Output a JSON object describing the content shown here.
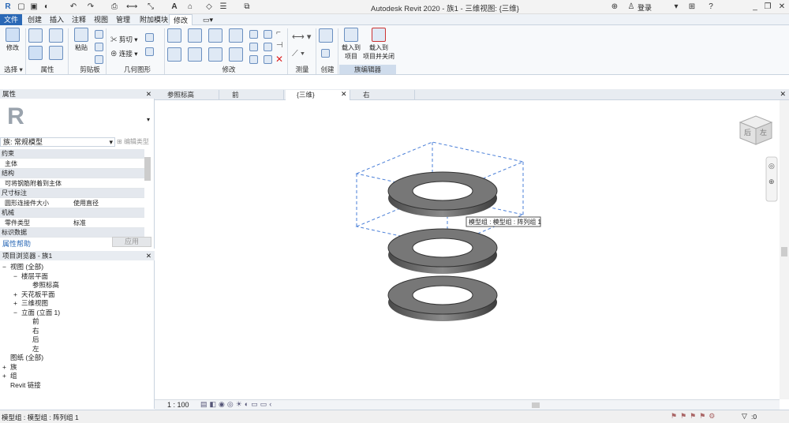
{
  "app_title": "Autodesk Revit 2020 - 族1 - 三维视图: {三维}",
  "signin": "登录",
  "ribbon_tabs": [
    "文件",
    "创建",
    "插入",
    "注释",
    "视图",
    "管理",
    "附加模块",
    "修改"
  ],
  "ribbon": {
    "modify_label": "修改",
    "select_label": "选择 ▾",
    "paste_label": "粘贴",
    "cut_label": "剪切",
    "join_label": "连接",
    "load_into_project": "载入到\n项目",
    "load_into_project_close": "载入到\n项目并关闭",
    "groups": [
      "选择",
      "属性",
      "剪贴板",
      "几何图形",
      "修改",
      "测量",
      "创建",
      "族编辑器"
    ]
  },
  "properties": {
    "title": "属性",
    "family_selector": "族: 常规模型",
    "edit_type": "编辑类型",
    "rows": [
      {
        "type": "section",
        "label": "约束"
      },
      {
        "type": "row",
        "key": "主体",
        "value": ""
      },
      {
        "type": "section",
        "label": "结构"
      },
      {
        "type": "row",
        "key": "可将钢筋附着到主体",
        "value": ""
      },
      {
        "type": "section",
        "label": "尺寸标注"
      },
      {
        "type": "row",
        "key": "圆形连接件大小",
        "value": "使用直径"
      },
      {
        "type": "section",
        "label": "机械"
      },
      {
        "type": "row",
        "key": "零件类型",
        "value": "标准"
      },
      {
        "type": "section",
        "label": "标识数据"
      }
    ],
    "help_link": "属性帮助",
    "apply_button": "应用"
  },
  "browser": {
    "title": "项目浏览器 - 族1",
    "items": [
      {
        "label": "视图 (全部)",
        "level": 0,
        "toggle": "−"
      },
      {
        "label": "楼层平面",
        "level": 1,
        "toggle": "−"
      },
      {
        "label": "参照标高",
        "level": 2,
        "toggle": ""
      },
      {
        "label": "天花板平面",
        "level": 1,
        "toggle": "+"
      },
      {
        "label": "三维视图",
        "level": 1,
        "toggle": "+"
      },
      {
        "label": "立面 (立面 1)",
        "level": 1,
        "toggle": "−"
      },
      {
        "label": "前",
        "level": 2,
        "toggle": ""
      },
      {
        "label": "右",
        "level": 2,
        "toggle": ""
      },
      {
        "label": "后",
        "level": 2,
        "toggle": ""
      },
      {
        "label": "左",
        "level": 2,
        "toggle": ""
      },
      {
        "label": "图纸 (全部)",
        "level": 0,
        "toggle": ""
      },
      {
        "label": "族",
        "level": 0,
        "toggle": "+"
      },
      {
        "label": "组",
        "level": 0,
        "toggle": "+"
      },
      {
        "label": "Revit 链接",
        "level": 0,
        "toggle": ""
      }
    ]
  },
  "view_tabs": [
    "参照标高",
    "前",
    "{三维}",
    "右"
  ],
  "canvas": {
    "tooltip": "模型组 : 模型组 : 阵列组 1",
    "viewcube_labels": [
      "后",
      "左"
    ]
  },
  "view_control": {
    "scale": "1 : 100"
  },
  "status_text": "模型组 : 模型组 : 阵列组 1",
  "status_right": ":0"
}
